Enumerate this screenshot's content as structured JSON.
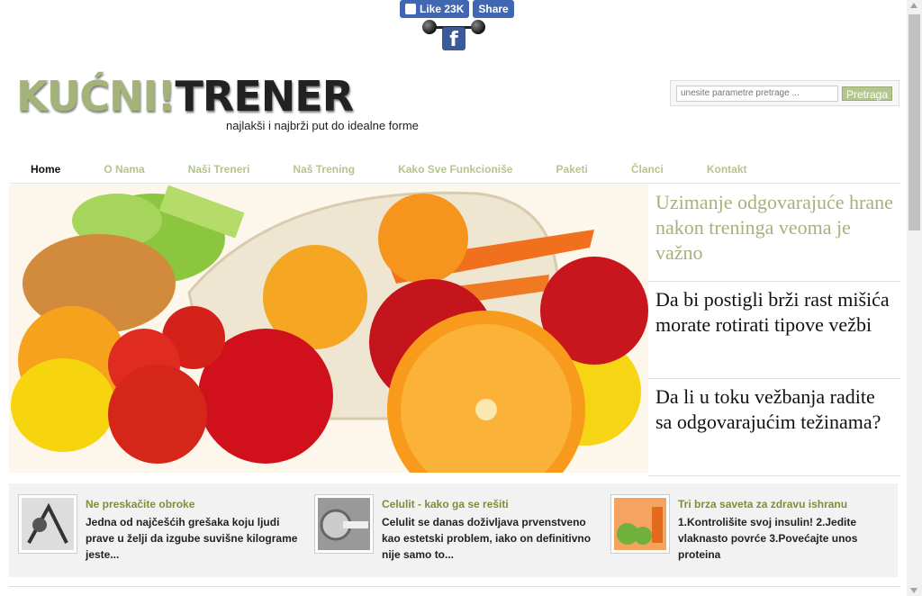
{
  "facebook": {
    "like_label": "Like 23K",
    "share_label": "Share",
    "icon_letter": "f"
  },
  "logo": {
    "part1": "KUĆNI!",
    "part2": "TRENER",
    "tagline": "najlakši i najbrži put do idealne forme"
  },
  "search": {
    "placeholder": "unesite parametre pretrage ...",
    "button": "Pretraga"
  },
  "nav": [
    {
      "label": "Home"
    },
    {
      "label": "O Nama"
    },
    {
      "label": "Naši Treneri"
    },
    {
      "label": "Naš Trening"
    },
    {
      "label": "Kako Sve Funkcioniše"
    },
    {
      "label": "Paketi"
    },
    {
      "label": "Članci"
    },
    {
      "label": "Kontakt"
    }
  ],
  "featured": [
    {
      "title": "Uzimanje odgovarajuće hrane nakon treninga veoma je važno"
    },
    {
      "title": "Da bi postigli brži rast mišića morate rotirati tipove vežbi"
    },
    {
      "title": "Da li u toku vežbanja radite sa odgovarajućim težinama?"
    }
  ],
  "cards": [
    {
      "title": "Ne preskačite obroke",
      "text": "Jedna od najčešćih grešaka koju ljudi prave u želji da izgube suvišne kilograme jeste..."
    },
    {
      "title": "Celulit - kako ga se rešiti",
      "text": "Celulit se danas doživljava prvenstveno kao estetski problem, iako on definitivno nije samo to..."
    },
    {
      "title": "Tri brza saveta za zdravu ishranu",
      "text": "1.Kontrolišite svoj insulin! 2.Jedite vlaknasto povrće 3.Povećajte unos proteina"
    }
  ],
  "colors": {
    "accent": "#a3b37a",
    "fb": "#4267b2",
    "card_title": "#7b8f3b"
  }
}
